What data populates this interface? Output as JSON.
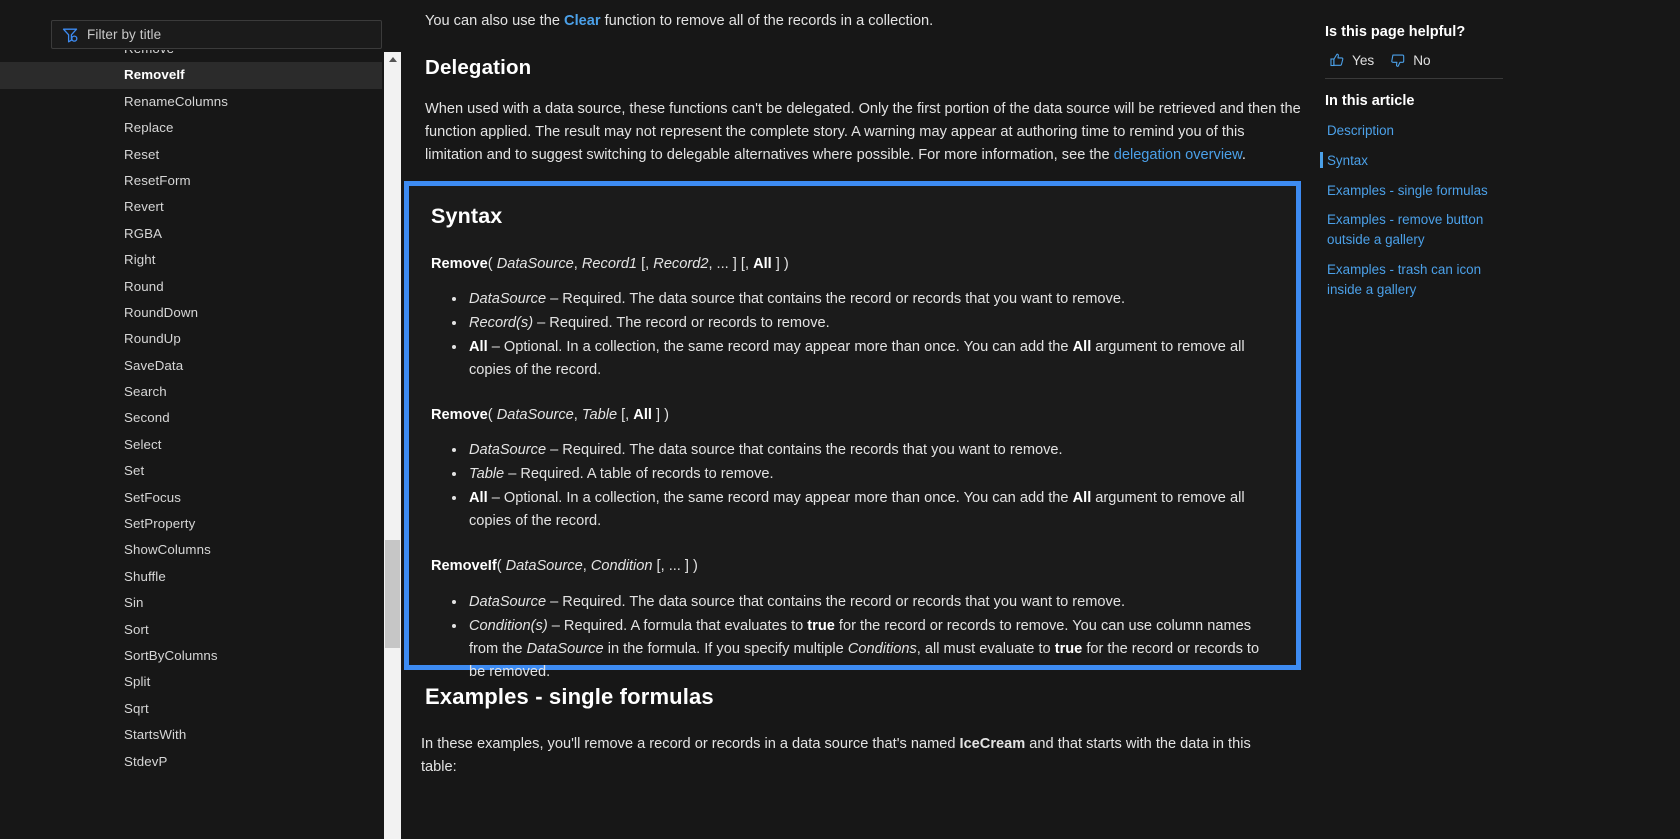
{
  "left_sidebar": {
    "filter": {
      "placeholder": "Filter by title",
      "value": "",
      "icon": "filter-icon"
    },
    "items": [
      {
        "label": "Remove",
        "selected": false
      },
      {
        "label": "RemoveIf",
        "selected": true
      },
      {
        "label": "RenameColumns",
        "selected": false
      },
      {
        "label": "Replace",
        "selected": false
      },
      {
        "label": "Reset",
        "selected": false
      },
      {
        "label": "ResetForm",
        "selected": false
      },
      {
        "label": "Revert",
        "selected": false
      },
      {
        "label": "RGBA",
        "selected": false
      },
      {
        "label": "Right",
        "selected": false
      },
      {
        "label": "Round",
        "selected": false
      },
      {
        "label": "RoundDown",
        "selected": false
      },
      {
        "label": "RoundUp",
        "selected": false
      },
      {
        "label": "SaveData",
        "selected": false
      },
      {
        "label": "Search",
        "selected": false
      },
      {
        "label": "Second",
        "selected": false
      },
      {
        "label": "Select",
        "selected": false
      },
      {
        "label": "Set",
        "selected": false
      },
      {
        "label": "SetFocus",
        "selected": false
      },
      {
        "label": "SetProperty",
        "selected": false
      },
      {
        "label": "ShowColumns",
        "selected": false
      },
      {
        "label": "Shuffle",
        "selected": false
      },
      {
        "label": "Sin",
        "selected": false
      },
      {
        "label": "Sort",
        "selected": false
      },
      {
        "label": "SortByColumns",
        "selected": false
      },
      {
        "label": "Split",
        "selected": false
      },
      {
        "label": "Sqrt",
        "selected": false
      },
      {
        "label": "StartsWith",
        "selected": false
      },
      {
        "label": "StdevP",
        "selected": false
      }
    ]
  },
  "main": {
    "lead_before": "You can also use the ",
    "lead_link": "Clear",
    "lead_after": " function to remove all of the records in a collection.",
    "delegation_heading": "Delegation",
    "delegation_before": "When used with a data source, these functions can't be delegated. Only the first portion of the data source will be retrieved and then the function applied. The result may not represent the complete story. A warning may appear at authoring time to remind you of this limitation and to suggest switching to delegable alternatives where possible. For more information, see the ",
    "delegation_link": "delegation overview",
    "delegation_after": ".",
    "syntax": {
      "heading": "Syntax",
      "blocks": [
        {
          "signature_name": "Remove",
          "signature_rest": "( DataSource, Record1 [, Record2, ... ] [, All ] )",
          "args": [
            {
              "term": "DataSource",
              "desc": " – Required. The data source that contains the record or records that you want to remove."
            },
            {
              "term": "Record(s)",
              "desc": " – Required. The record or records to remove."
            },
            {
              "term": "All",
              "desc": " – Optional. In a collection, the same record may appear more than once. You can add the All argument to remove all copies of the record."
            }
          ]
        },
        {
          "signature_name": "Remove",
          "signature_rest": "( DataSource, Table [, All ] )",
          "args": [
            {
              "term": "DataSource",
              "desc": " – Required. The data source that contains the records that you want to remove."
            },
            {
              "term": "Table",
              "desc": " – Required. A table of records to remove."
            },
            {
              "term": "All",
              "desc": " – Optional. In a collection, the same record may appear more than once. You can add the All argument to remove all copies of the record."
            }
          ]
        },
        {
          "signature_name": "RemoveIf",
          "signature_rest": "( DataSource, Condition [, ... ] )",
          "args": [
            {
              "term": "DataSource",
              "desc": " – Required. The data source that contains the record or records that you want to remove."
            },
            {
              "term": "Condition(s)",
              "desc": " – Required. A formula that evaluates to true for the record or records to remove. You can use column names from the DataSource in the formula. If you specify multiple Conditions, all must evaluate to true for the record or records to be removed."
            }
          ]
        }
      ]
    },
    "examples_heading": "Examples - single formulas",
    "examples_before": "In these examples, you'll remove a record or records in a data source that's named ",
    "examples_bold": "IceCream",
    "examples_after": " and that starts with the data in this table:"
  },
  "right_sidebar": {
    "helpful_title": "Is this page helpful?",
    "yes_label": "Yes",
    "no_label": "No",
    "toc_title": "In this article",
    "toc_items": [
      {
        "label": "Description",
        "active": false
      },
      {
        "label": "Syntax",
        "active": true
      },
      {
        "label": "Examples - single formulas",
        "active": false
      },
      {
        "label": "Examples - remove button outside a gallery",
        "active": false
      },
      {
        "label": "Examples - trash can icon inside a gallery",
        "active": false
      }
    ]
  },
  "colors": {
    "background": "#171717",
    "accent_blue": "#3d8bf2",
    "link_blue": "#4ba0e8",
    "selected_row": "#2b2b2b",
    "scrollbar_track": "#f2f2f2",
    "scrollbar_thumb": "#c6c6c6"
  }
}
